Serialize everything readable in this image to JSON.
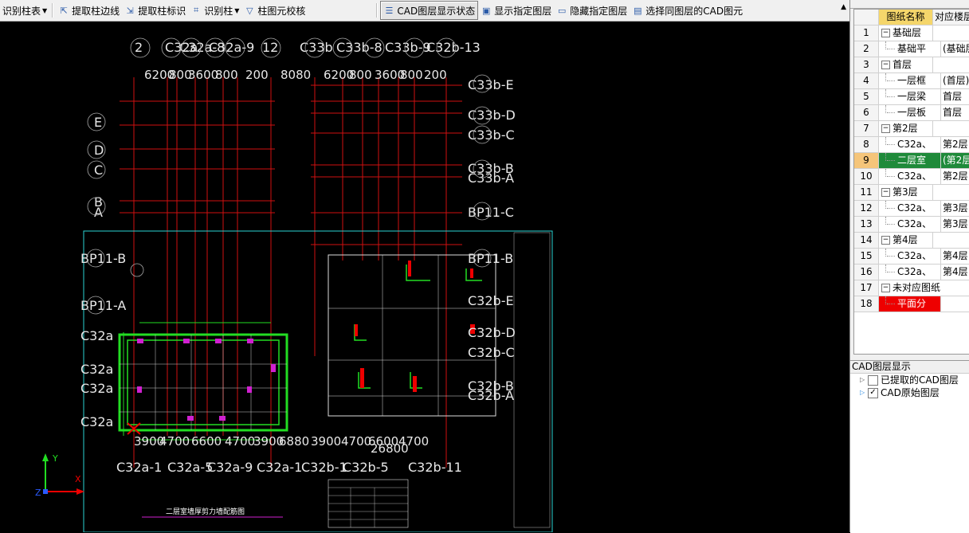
{
  "toolbar": {
    "items": [
      {
        "label": "识别柱表",
        "icon": "dropdown-caret-icon"
      },
      {
        "label": "提取柱边线",
        "icon": "extract-edge-icon"
      },
      {
        "label": "提取柱标识",
        "icon": "extract-mark-icon"
      },
      {
        "label": "识别柱",
        "icon": "identify-column-icon"
      },
      {
        "label": "柱图元校核",
        "icon": "check-icon"
      },
      {
        "label": "CAD图层显示状态",
        "icon": "layer-state-icon"
      },
      {
        "label": "显示指定图层",
        "icon": "show-layer-icon"
      },
      {
        "label": "隐藏指定图层",
        "icon": "hide-layer-icon"
      },
      {
        "label": "选择同图层的CAD图元",
        "icon": "select-layer-icon"
      }
    ]
  },
  "drawing_list": {
    "headers": {
      "name": "图纸名称",
      "floor": "对应楼层"
    },
    "rows": [
      {
        "num": "1",
        "name": "基础层",
        "floor": ""
      },
      {
        "num": "2",
        "name": "基础平",
        "floor": "(基础层"
      },
      {
        "num": "3",
        "name": "首层",
        "floor": ""
      },
      {
        "num": "4",
        "name": "一层框",
        "floor": "(首层)"
      },
      {
        "num": "5",
        "name": "一层梁",
        "floor": "首层"
      },
      {
        "num": "6",
        "name": "一层板",
        "floor": "首层"
      },
      {
        "num": "7",
        "name": "第2层",
        "floor": ""
      },
      {
        "num": "8",
        "name": "C32a、",
        "floor": "第2层"
      },
      {
        "num": "9",
        "name": "二层室",
        "floor": "(第2层)"
      },
      {
        "num": "10",
        "name": "C32a、",
        "floor": "第2层"
      },
      {
        "num": "11",
        "name": "第3层",
        "floor": ""
      },
      {
        "num": "12",
        "name": "C32a、",
        "floor": "第3层"
      },
      {
        "num": "13",
        "name": "C32a、",
        "floor": "第3层"
      },
      {
        "num": "14",
        "name": "第4层",
        "floor": ""
      },
      {
        "num": "15",
        "name": "C32a、",
        "floor": "第4层"
      },
      {
        "num": "16",
        "name": "C32a、",
        "floor": "第4层"
      },
      {
        "num": "17",
        "name": "未对应图纸",
        "floor": ""
      },
      {
        "num": "18",
        "name": "平面分",
        "floor": ""
      }
    ]
  },
  "layer_panel": {
    "title": "CAD图层显示",
    "items": [
      {
        "label": "已提取的CAD图层",
        "checked": false
      },
      {
        "label": "CAD原始图层",
        "checked": true
      }
    ]
  },
  "cad": {
    "top_axes": [
      "2",
      "C32a",
      "C32a-8",
      "C32a-9",
      "12",
      "C33b",
      "C33b-8",
      "C33b-9",
      "C32b-13"
    ],
    "top_dims": [
      "6200",
      "800",
      "3600",
      "800",
      "200",
      "8080",
      "6200",
      "800",
      "3600",
      "800",
      "200"
    ],
    "left_axes": [
      "E",
      "D",
      "C",
      "B",
      "A",
      "BP11-B",
      "BP11-A",
      "C32a",
      "C32a",
      "C32a",
      "C32a"
    ],
    "right_axes": [
      "C33b-E",
      "C33b-D",
      "C33b-C",
      "C33b-B",
      "C33b-A",
      "BP11-C",
      "BP11-B",
      "C32b-E",
      "C32b-D",
      "C32b-C",
      "C32b-B",
      "C32b-A"
    ],
    "bottom_axes": [
      "C32a-1",
      "C32a-5",
      "C32a-9",
      "C32a-1",
      "C32b-1",
      "C32b-5",
      "C32b-11"
    ],
    "bottom_dims": [
      "3900",
      "4700",
      "6600",
      "4700",
      "3900",
      "6880",
      "3900",
      "4700",
      "6600",
      "4700",
      "26800"
    ],
    "drawing_title": "二层室墙厚剪力墙配筋图"
  },
  "colors": {
    "grid_red": "#d01010",
    "wall_green": "#22dd22",
    "frame_cyan": "#2ad4d4",
    "select_green": "#1f8a3a",
    "header_yellow": "#f5d66b"
  }
}
